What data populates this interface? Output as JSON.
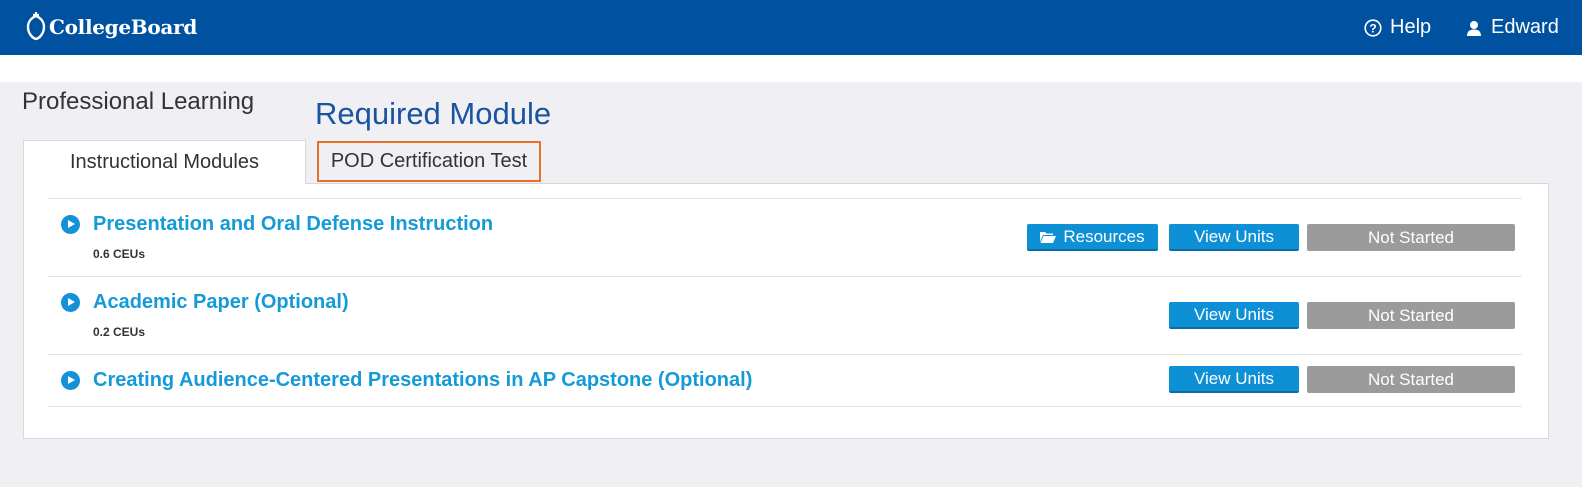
{
  "header": {
    "logo_text": "CollegeBoard",
    "help_label": "Help",
    "user_name": "Edward"
  },
  "page": {
    "title": "Professional Learning",
    "annotation": "Required Module"
  },
  "tabs": [
    {
      "label": "Instructional Modules",
      "active": true
    },
    {
      "label": "POD Certification Test",
      "active": false,
      "highlighted": true
    }
  ],
  "modules": [
    {
      "title": "Presentation and Oral Defense Instruction",
      "ceus": "0.6 CEUs",
      "resources_label": "Resources",
      "view_units_label": "View Units",
      "status": "Not Started"
    },
    {
      "title": "Academic Paper (Optional)",
      "ceus": "0.2 CEUs",
      "view_units_label": "View Units",
      "status": "Not Started"
    },
    {
      "title": "Creating Audience-Centered Presentations in AP Capstone (Optional)",
      "view_units_label": "View Units",
      "status": "Not Started"
    }
  ],
  "colors": {
    "header_bg": "#0052a0",
    "link_blue": "#159ad8",
    "button_blue": "#0d90d6",
    "status_gray": "#9b9b9b",
    "highlight_orange": "#e8702a"
  }
}
